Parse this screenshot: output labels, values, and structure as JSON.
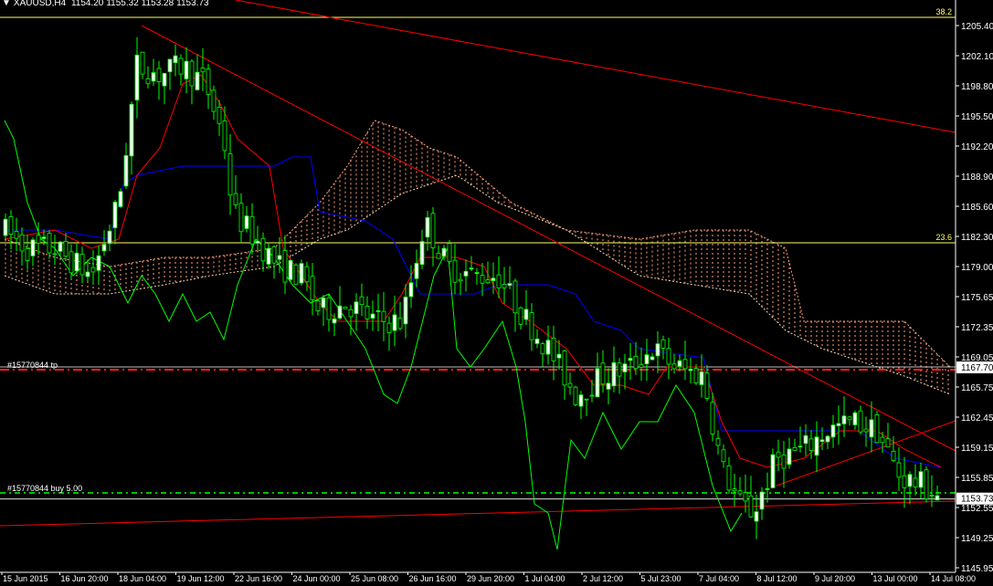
{
  "symbol_bar": {
    "arrow": "▼",
    "symbol": "XAUUSD,H4",
    "ohlc": [
      "1154.20",
      "1155.32",
      "1153.28",
      "1153.73"
    ]
  },
  "colors": {
    "background": "#000000",
    "bull_candle": "#ffffff",
    "bear_candle": "#000000",
    "candle_outline": "#00ff00",
    "tenkan": "#ff0000",
    "kijun": "#0000ff",
    "chikou": "#00ff00",
    "senkou_a": "#ffa07a",
    "senkou_b": "#ffd9b3",
    "fibo": "#ffff66",
    "trendline": "#ff0000",
    "tp_line": "#ff2020",
    "entry_line": "#00ff00",
    "axis": "#ffffff"
  },
  "price_axis": {
    "labels": [
      "1205.40",
      "1202.10",
      "1198.80",
      "1195.50",
      "1192.20",
      "1188.90",
      "1185.60",
      "1182.30",
      "1179.00",
      "1175.65",
      "1172.35",
      "1169.05",
      "1165.75",
      "1162.45",
      "1159.15",
      "1155.85",
      "1152.55",
      "1149.25",
      "1145.95"
    ],
    "current_price": "1153.73",
    "tp_price": "1167.70"
  },
  "time_axis": {
    "labels": [
      "15 Jun 2015",
      "16 Jun 20:00",
      "18 Jun 04:00",
      "19 Jun 12:00",
      "22 Jun 16:00",
      "24 Jun 00:00",
      "25 Jun 08:00",
      "26 Jun 16:00",
      "29 Jun 20:00",
      "1 Jul 04:00",
      "2 Jul 12:00",
      "5 Jul 23:00",
      "7 Jul 04:00",
      "8 Jul 12:00",
      "9 Jul 20:00",
      "13 Jul 00:00",
      "14 Jul 08:00"
    ]
  },
  "fibo_levels": [
    {
      "label": "38.2",
      "price": 1206.3
    },
    {
      "label": "23.6",
      "price": 1181.6
    }
  ],
  "order_lines": [
    {
      "label": "#15770844 tp",
      "price": 1167.7,
      "type": "tp"
    },
    {
      "label": "#15770844 buy 5.00",
      "price": 1154.2,
      "type": "entry"
    }
  ]
}
